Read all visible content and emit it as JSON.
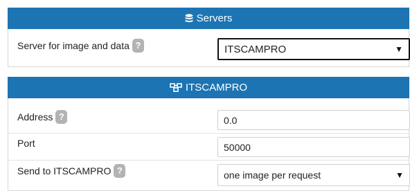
{
  "servers_panel": {
    "title": "Servers",
    "server_label": "Server for image and data",
    "server_value": "ITSCAMPRO"
  },
  "its_panel": {
    "title": "ITSCAMPRO",
    "address_label": "Address",
    "address_value": "0.0",
    "port_label": "Port",
    "port_value": "50000",
    "send_label": "Send to ITSCAMPRO",
    "send_value": "one image per request"
  },
  "help_glyph": "?",
  "dropdown_arrow": "▼",
  "colors": {
    "header_bg": "#1c74b3",
    "help_bg": "#b3b3b3"
  }
}
